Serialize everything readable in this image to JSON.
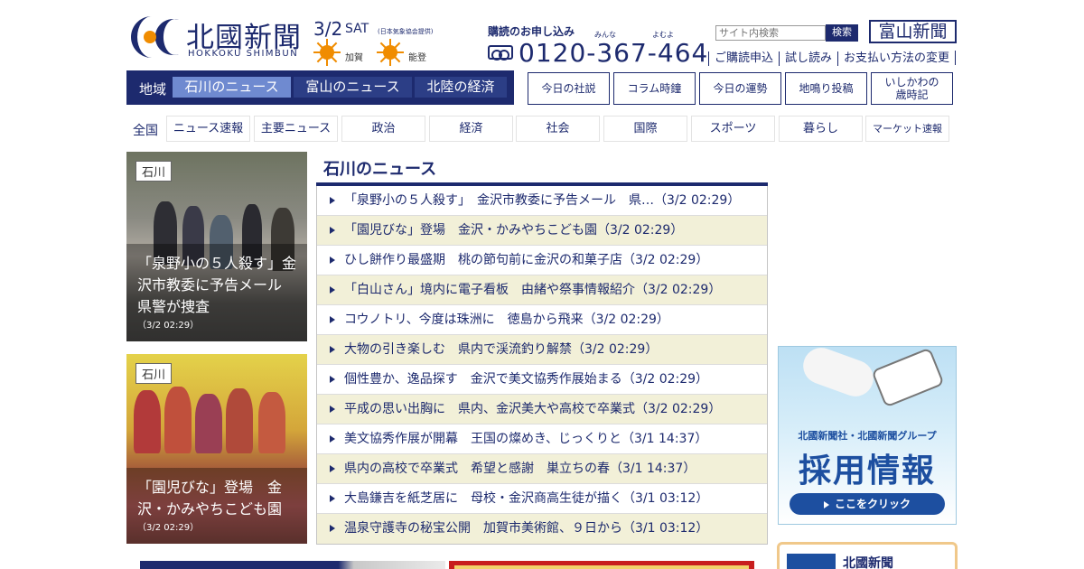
{
  "header": {
    "logo_main": "北國新聞",
    "logo_sub": "HOKKOKU SHIMBUN",
    "date": "3/2",
    "weekday": "SAT",
    "weather_provider": "(日本気象協会提供)",
    "weather": [
      {
        "area": "加賀",
        "icon": "sun-icon"
      },
      {
        "area": "能登",
        "icon": "sun-icon"
      }
    ],
    "subscribe_label": "購読のお申し込み",
    "tel_kana": [
      "みんな",
      "よむよ"
    ],
    "tel": "0120-367-464",
    "search_placeholder": "サイト内検索",
    "search_button": "検索",
    "toyama_logo": "富山新聞",
    "sublinks": [
      "ご購読申込",
      "試し読み",
      "お支払い方法の変更"
    ]
  },
  "region_nav": {
    "label": "地域",
    "tabs": [
      "石川のニュース",
      "富山のニュース",
      "北陸の経済"
    ]
  },
  "quick_links": [
    "今日の社説",
    "コラム時鐘",
    "今日の運勢",
    "地鳴り投稿",
    "いしかわの\n歳時記"
  ],
  "categories": {
    "all": "全国",
    "tabs": [
      "ニュース速報",
      "主要ニュース",
      "政治",
      "経済",
      "社会",
      "国際",
      "スポーツ",
      "暮らし",
      "マーケット速報"
    ]
  },
  "features": [
    {
      "tag": "石川",
      "caption": "「泉野小の５人殺す」金沢市教委に予告メール　県警が捜査",
      "time": "（3/2 02:29）"
    },
    {
      "tag": "石川",
      "caption": "「園児びな」登場　金沢・かみやちこども園",
      "time": "（3/2 02:29）"
    }
  ],
  "news": {
    "title": "石川のニュース",
    "items": [
      "「泉野小の５人殺す」　金沢市教委に予告メール　県…（3/2 02:29）",
      "「園児びな」登場　金沢・かみやちこども園（3/2 02:29）",
      "ひし餅作り最盛期　桃の節句前に金沢の和菓子店（3/2 02:29）",
      "「白山さん」境内に電子看板　由緒や祭事情報紹介（3/2 02:29）",
      "コウノトリ、今度は珠洲に　徳島から飛来（3/2 02:29）",
      "大物の引き楽しむ　県内で渓流釣り解禁（3/2 02:29）",
      "個性豊か、逸品探す　金沢で美文協秀作展始まる（3/2 02:29）",
      "平成の思い出胸に　県内、金沢美大や高校で卒業式（3/2 02:29）",
      "美文協秀作展が開幕　王国の燦めき、じっくりと（3/1 14:37）",
      "県内の高校で卒業式　希望と感謝　巣立ちの春（3/1 14:37）",
      "大島鎌吉を紙芝居に　母校・金沢商高生徒が描く（3/1 03:12）",
      "温泉守護寺の秘宝公開　加賀市美術館、９日から（3/1 03:12）"
    ]
  },
  "recruit": {
    "sub": "北國新聞社・北國新聞グループ",
    "main": "採用情報",
    "button": "ここをクリック"
  },
  "promo": {
    "title": "北國新聞"
  }
}
